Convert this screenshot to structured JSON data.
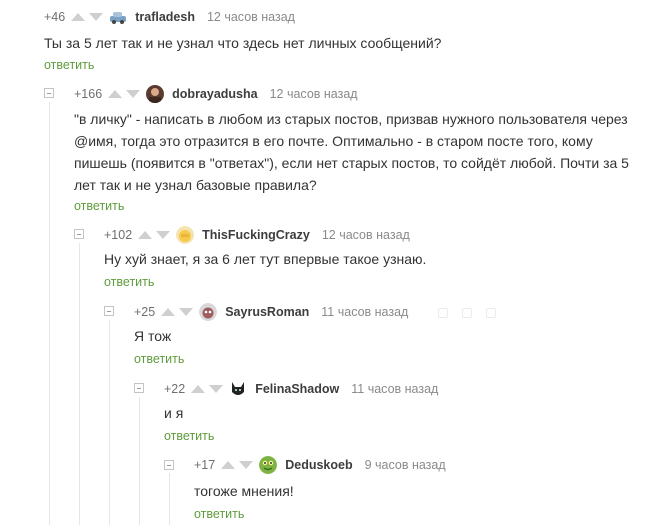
{
  "comments": [
    {
      "rating": "+46",
      "author": "trafladesh",
      "time": "12 часов назад",
      "text": "Ты за 5 лет так и не узнал что здесь нет личных сообщений?",
      "reply_label": "ответить",
      "avatar_icon": "car-avatar-icon"
    },
    {
      "rating": "+166",
      "author": "dobrayadusha",
      "time": "12 часов назад",
      "text": "\"в личку\" - написать в любом из старых постов, призвав нужного пользователя через @имя, тогда это отразится в его почте. Оптимально - в старом посте того, кому пишешь (появится в \"ответах\"), если нет старых постов, то сойдёт любой. Почти за 5 лет так и не узнал базовые правила?",
      "reply_label": "ответить",
      "avatar_icon": "portrait-avatar-icon"
    },
    {
      "rating": "+102",
      "author": "ThisFuckingCrazy",
      "time": "12 часов назад",
      "text": "Ну хуй знает, я за 6 лет тут впервые такое узнаю.",
      "reply_label": "ответить",
      "avatar_icon": "facepalm-avatar-icon"
    },
    {
      "rating": "+25",
      "author": "SayrusRoman",
      "time": "11 часов назад",
      "text": "Я тож",
      "reply_label": "ответить",
      "avatar_icon": "cat-avatar-icon"
    },
    {
      "rating": "+22",
      "author": "FelinaShadow",
      "time": "11 часов назад",
      "text": "и я",
      "reply_label": "ответить",
      "avatar_icon": "black-cat-avatar-icon"
    },
    {
      "rating": "+17",
      "author": "Deduskoeb",
      "time": "9 часов назад",
      "text": "тогоже мнения!",
      "reply_label": "ответить",
      "avatar_icon": "frog-avatar-icon"
    }
  ],
  "colors": {
    "reply_link": "#5f9c3c",
    "vote_arrow": "#cfcfcf",
    "thread_line": "#e6e6e6"
  }
}
